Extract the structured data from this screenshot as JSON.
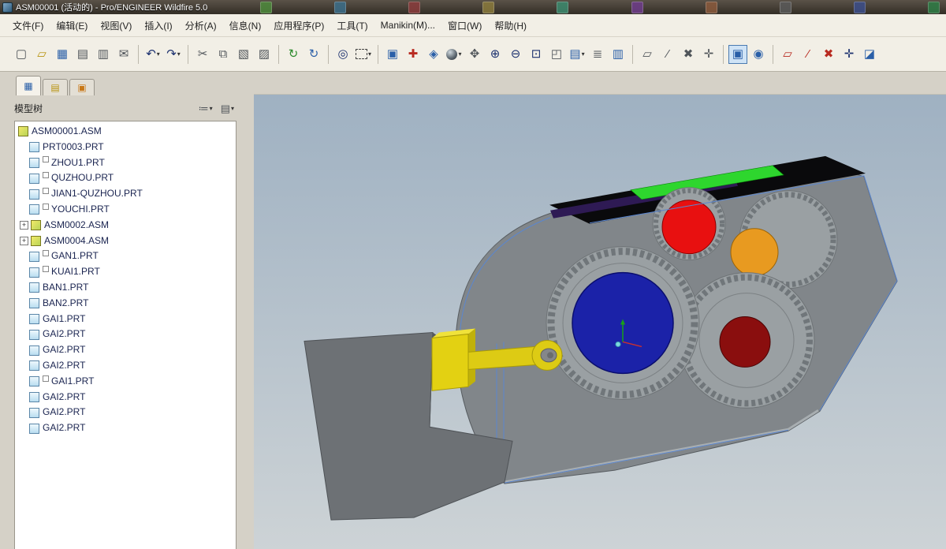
{
  "window": {
    "title": "ASM00001 (活动的) - Pro/ENGINEER Wildfire 5.0"
  },
  "titlebar": {
    "desktop_icon_colors": [
      "#4e8a3c",
      "#3c6e8a",
      "#8a3c3c",
      "#8a7a3c",
      "#3c8a6e",
      "#6e3c8a",
      "#8a5a3c",
      "#5a5a5a",
      "#3c4e8a",
      "#2e7d46"
    ]
  },
  "menu": {
    "items": [
      "文件(F)",
      "编辑(E)",
      "视图(V)",
      "插入(I)",
      "分析(A)",
      "信息(N)",
      "应用程序(P)",
      "工具(T)",
      "Manikin(M)...",
      "窗口(W)",
      "帮助(H)"
    ]
  },
  "toolbar": {
    "groups": [
      {
        "name": "file",
        "buttons": [
          {
            "name": "new-button",
            "glyph": "▢",
            "cls": "c-gray"
          },
          {
            "name": "open-button",
            "glyph": "▱",
            "cls": "c-yellow"
          },
          {
            "name": "save-button",
            "glyph": "▦",
            "cls": "c-blue"
          },
          {
            "name": "print-button",
            "glyph": "▤",
            "cls": "c-gray"
          },
          {
            "name": "print-preview-button",
            "glyph": "▥",
            "cls": "c-gray"
          },
          {
            "name": "send-mail-button",
            "glyph": "✉",
            "cls": "c-gray"
          }
        ]
      },
      {
        "name": "undo-redo",
        "buttons": [
          {
            "name": "undo-button",
            "glyph": "↶",
            "cls": "c-navy",
            "dropdown": true
          },
          {
            "name": "redo-button",
            "glyph": "↷",
            "cls": "c-navy",
            "dropdown": true
          }
        ]
      },
      {
        "name": "clipboard",
        "buttons": [
          {
            "name": "cut-button",
            "glyph": "✂",
            "cls": "c-gray"
          },
          {
            "name": "copy-button",
            "glyph": "⧉",
            "cls": "c-gray"
          },
          {
            "name": "paste-button",
            "glyph": "▧",
            "cls": "c-gray"
          },
          {
            "name": "paste-special-button",
            "glyph": "▨",
            "cls": "c-gray"
          }
        ]
      },
      {
        "name": "regenerate",
        "buttons": [
          {
            "name": "regenerate-button",
            "glyph": "↻",
            "cls": "c-green"
          },
          {
            "name": "regenerate-manager-button",
            "glyph": "↻",
            "cls": "c-blue"
          }
        ]
      },
      {
        "name": "search",
        "buttons": [
          {
            "name": "find-button",
            "glyph": "◎",
            "cls": "c-navy"
          },
          {
            "name": "selection-filter-button",
            "cls": "dashed",
            "dropdown": true
          }
        ]
      },
      {
        "name": "view",
        "buttons": [
          {
            "name": "repaint-button",
            "glyph": "▣",
            "cls": "c-blue"
          },
          {
            "name": "spin-center-button",
            "glyph": "✚",
            "cls": "c-red"
          },
          {
            "name": "reorient-button",
            "glyph": "◈",
            "cls": "c-blue"
          },
          {
            "name": "shaded-view-button",
            "cls": "sphere",
            "dropdown": true
          },
          {
            "name": "pan-zoom-button",
            "glyph": "✥",
            "cls": "c-gray"
          },
          {
            "name": "zoom-in-button",
            "glyph": "⊕",
            "cls": "c-navy"
          },
          {
            "name": "zoom-out-button",
            "glyph": "⊖",
            "cls": "c-navy"
          },
          {
            "name": "refit-button",
            "glyph": "⊡",
            "cls": "c-navy"
          },
          {
            "name": "view-orientation-button",
            "glyph": "◰",
            "cls": "c-gray"
          },
          {
            "name": "saved-views-button",
            "glyph": "▤",
            "cls": "c-blue",
            "dropdown": true
          },
          {
            "name": "layers-button",
            "glyph": "≣",
            "cls": "c-gray"
          },
          {
            "name": "view-manager-button",
            "glyph": "▥",
            "cls": "c-blue"
          }
        ]
      },
      {
        "name": "datum-display",
        "buttons": [
          {
            "name": "plane-display-toggle",
            "glyph": "▱",
            "cls": "c-gray"
          },
          {
            "name": "axis-display-toggle",
            "glyph": "⁄",
            "cls": "c-gray"
          },
          {
            "name": "point-display-toggle",
            "glyph": "✖",
            "cls": "c-gray"
          },
          {
            "name": "csys-display-toggle",
            "glyph": "✛",
            "cls": "c-gray"
          }
        ]
      },
      {
        "name": "model-display",
        "buttons": [
          {
            "name": "shaded-display-toggle",
            "glyph": "▣",
            "cls": "c-blue",
            "active": true
          },
          {
            "name": "render-setup-button",
            "glyph": "◉",
            "cls": "c-blue"
          }
        ]
      },
      {
        "name": "datum-create",
        "buttons": [
          {
            "name": "datum-plane-button",
            "glyph": "▱",
            "cls": "c-red"
          },
          {
            "name": "datum-axis-button",
            "glyph": "⁄",
            "cls": "c-red"
          },
          {
            "name": "datum-point-button",
            "glyph": "✖",
            "cls": "c-red"
          },
          {
            "name": "datum-csys-button",
            "glyph": "✛",
            "cls": "c-navy"
          },
          {
            "name": "sketch-button",
            "glyph": "◪",
            "cls": "c-blue"
          }
        ]
      }
    ]
  },
  "sidebar": {
    "tabs": [
      {
        "name": "model-tree-tab",
        "glyph": "▦",
        "cls": "c-blue",
        "active": true
      },
      {
        "name": "folder-browser-tab",
        "glyph": "▤",
        "cls": "c-yellow",
        "active": false
      },
      {
        "name": "favorites-tab",
        "glyph": "▣",
        "cls": "c-orange",
        "active": false
      }
    ],
    "tree_header": {
      "title": "模型树",
      "show_glyph": "≔",
      "settings_glyph": "▤"
    },
    "tree": {
      "items": [
        {
          "label": "ASM00001.ASM",
          "icon": "asm",
          "indent": 0,
          "prefix": false,
          "expander": ""
        },
        {
          "label": "PRT0003.PRT",
          "icon": "prt",
          "indent": 1,
          "prefix": false,
          "expander": ""
        },
        {
          "label": "ZHOU1.PRT",
          "icon": "prt",
          "indent": 1,
          "prefix": true,
          "expander": ""
        },
        {
          "label": "QUZHOU.PRT",
          "icon": "prt",
          "indent": 1,
          "prefix": true,
          "expander": ""
        },
        {
          "label": "JIAN1-QUZHOU.PRT",
          "icon": "prt",
          "indent": 1,
          "prefix": true,
          "expander": ""
        },
        {
          "label": "YOUCHI.PRT",
          "icon": "prt",
          "indent": 1,
          "prefix": true,
          "expander": ""
        },
        {
          "label": "ASM0002.ASM",
          "icon": "asm",
          "indent": 1,
          "prefix": false,
          "expander": "+"
        },
        {
          "label": "ASM0004.ASM",
          "icon": "asm",
          "indent": 1,
          "prefix": false,
          "expander": "+"
        },
        {
          "label": "GAN1.PRT",
          "icon": "prt",
          "indent": 1,
          "prefix": true,
          "expander": ""
        },
        {
          "label": "KUAI1.PRT",
          "icon": "prt",
          "indent": 1,
          "prefix": true,
          "expander": ""
        },
        {
          "label": "BAN1.PRT",
          "icon": "prt",
          "indent": 1,
          "prefix": false,
          "expander": ""
        },
        {
          "label": "BAN2.PRT",
          "icon": "prt",
          "indent": 1,
          "prefix": false,
          "expander": ""
        },
        {
          "label": "GAI1.PRT",
          "icon": "prt",
          "indent": 1,
          "prefix": false,
          "expander": ""
        },
        {
          "label": "GAI2.PRT",
          "icon": "prt",
          "indent": 1,
          "prefix": false,
          "expander": ""
        },
        {
          "label": "GAI2.PRT",
          "icon": "prt",
          "indent": 1,
          "prefix": false,
          "expander": ""
        },
        {
          "label": "GAI2.PRT",
          "icon": "prt",
          "indent": 1,
          "prefix": false,
          "expander": ""
        },
        {
          "label": "GAI1.PRT",
          "icon": "prt",
          "indent": 1,
          "prefix": true,
          "expander": ""
        },
        {
          "label": "GAI2.PRT",
          "icon": "prt",
          "indent": 1,
          "prefix": false,
          "expander": ""
        },
        {
          "label": "GAI2.PRT",
          "icon": "prt",
          "indent": 1,
          "prefix": false,
          "expander": ""
        },
        {
          "label": "GAI2.PRT",
          "icon": "prt",
          "indent": 1,
          "prefix": false,
          "expander": ""
        }
      ]
    }
  },
  "viewport": {
    "background_top": "#9fb1c2",
    "background_bottom": "#cdd3d6",
    "model": {
      "housing": "#81868a",
      "gear": "#9aa0a3",
      "hub_blue": "#1b22a8",
      "knob_red": "#e81010",
      "knob_orange": "#e89a20",
      "knob_dark_red": "#8a0e0e",
      "strip_green": "#2ed62e",
      "band_black": "#0a0a0c",
      "strip_purple": "#2e1a54",
      "part_yellow": "#e3d112",
      "bracket": "#6d7175",
      "edge_blue": "#5b86cf"
    }
  }
}
